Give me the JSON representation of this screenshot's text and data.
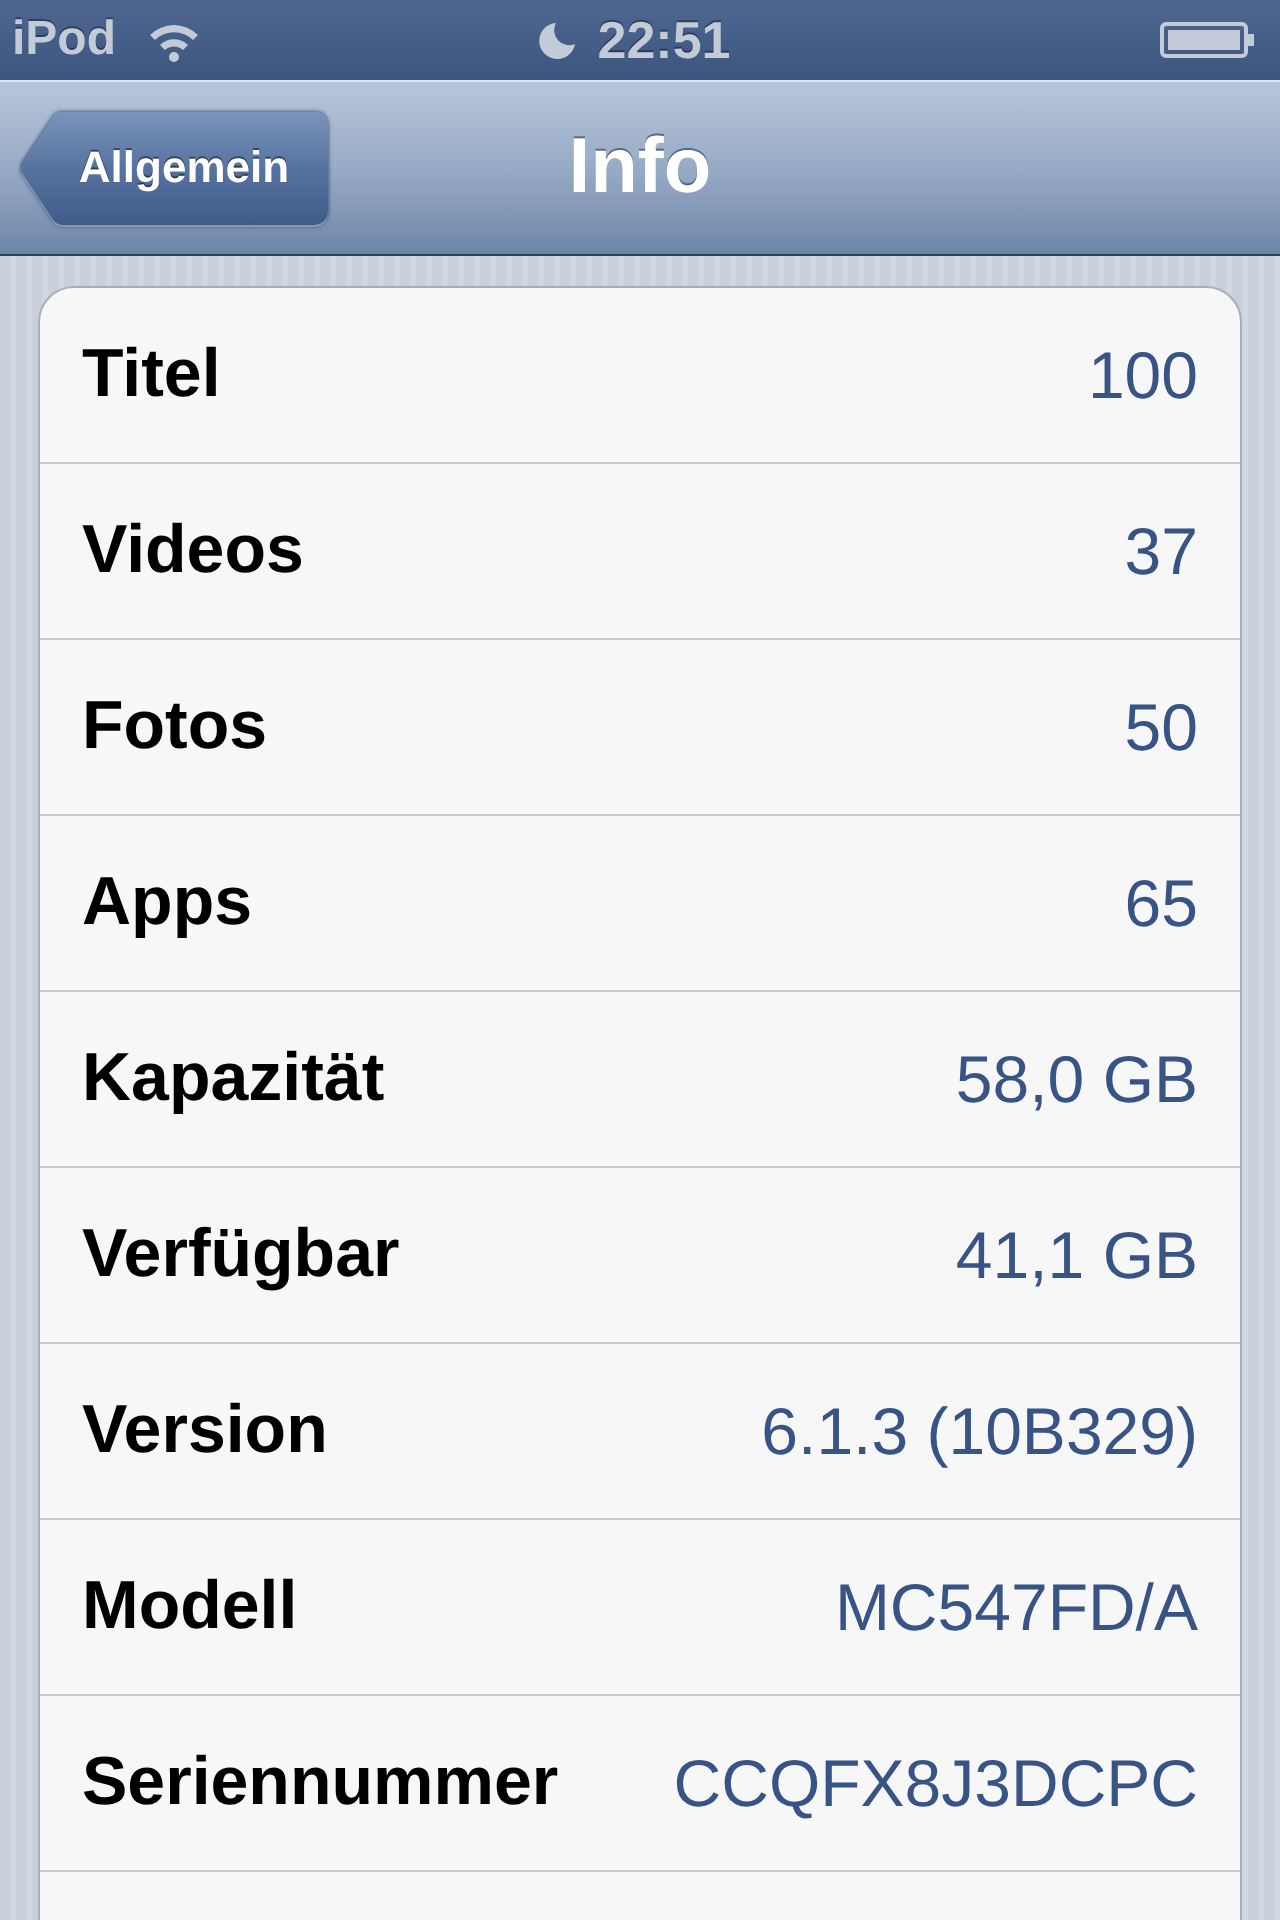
{
  "status_bar": {
    "carrier": "iPod",
    "time": "22:51"
  },
  "nav_bar": {
    "back_button": "Allgemein",
    "title": "Info"
  },
  "rows": [
    {
      "label": "Titel",
      "value": "100"
    },
    {
      "label": "Videos",
      "value": "37"
    },
    {
      "label": "Fotos",
      "value": "50"
    },
    {
      "label": "Apps",
      "value": "65"
    },
    {
      "label": "Kapazität",
      "value": "58,0 GB"
    },
    {
      "label": "Verfügbar",
      "value": "41,1 GB"
    },
    {
      "label": "Version",
      "value": "6.1.3 (10B329)"
    },
    {
      "label": "Modell",
      "value": "MC547FD/A"
    },
    {
      "label": "Seriennummer",
      "value": "CCQFX8J3DCPC"
    }
  ]
}
